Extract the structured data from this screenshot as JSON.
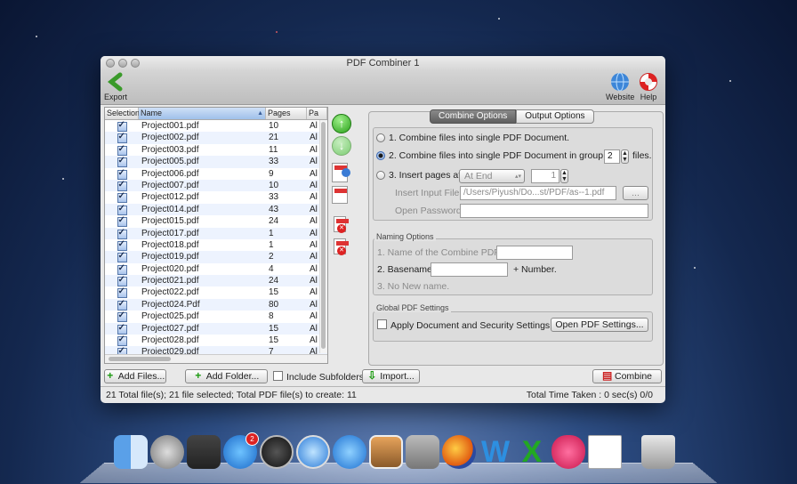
{
  "window": {
    "title": "PDF Combiner 1"
  },
  "toolbar": {
    "export_label": "Export",
    "website_label": "Website",
    "help_label": "Help"
  },
  "table": {
    "columns": [
      "Selection",
      "Name",
      "Pages",
      "Pa"
    ],
    "rows": [
      {
        "name": "Project001.pdf",
        "pages": "10",
        "pa": "Al"
      },
      {
        "name": "Project002.pdf",
        "pages": "21",
        "pa": "Al"
      },
      {
        "name": "Project003.pdf",
        "pages": "11",
        "pa": "Al"
      },
      {
        "name": "Project005.pdf",
        "pages": "33",
        "pa": "Al"
      },
      {
        "name": "Project006.pdf",
        "pages": "9",
        "pa": "Al"
      },
      {
        "name": "Project007.pdf",
        "pages": "10",
        "pa": "Al"
      },
      {
        "name": "Project012.pdf",
        "pages": "33",
        "pa": "Al"
      },
      {
        "name": "Project014.pdf",
        "pages": "43",
        "pa": "Al"
      },
      {
        "name": "Project015.pdf",
        "pages": "24",
        "pa": "Al"
      },
      {
        "name": "Project017.pdf",
        "pages": "1",
        "pa": "Al"
      },
      {
        "name": "Project018.pdf",
        "pages": "1",
        "pa": "Al"
      },
      {
        "name": "Project019.pdf",
        "pages": "2",
        "pa": "Al"
      },
      {
        "name": "Project020.pdf",
        "pages": "4",
        "pa": "Al"
      },
      {
        "name": "Project021.pdf",
        "pages": "24",
        "pa": "Al"
      },
      {
        "name": "Project022.pdf",
        "pages": "15",
        "pa": "Al"
      },
      {
        "name": "Project024.Pdf",
        "pages": "80",
        "pa": "Al"
      },
      {
        "name": "Project025.pdf",
        "pages": "8",
        "pa": "Al"
      },
      {
        "name": "Project027.pdf",
        "pages": "15",
        "pa": "Al"
      },
      {
        "name": "Project028.pdf",
        "pages": "15",
        "pa": "Al"
      },
      {
        "name": "Project029.pdf",
        "pages": "7",
        "pa": "Al"
      }
    ]
  },
  "tabs": {
    "combine": "Combine Options",
    "output": "Output Options"
  },
  "combine_options": {
    "opt1": "1. Combine files into single PDF Document.",
    "opt2_pre": "2. Combine files into single PDF Document in group of",
    "opt2_value": "2",
    "opt2_post": "files.",
    "opt3": "3. Insert pages at",
    "insert_at": "At End",
    "insert_page": "1",
    "insert_input_label": "Insert Input File",
    "insert_input_value": "/Users/Piyush/Do...st/PDF/as--1.pdf",
    "browse": "...",
    "open_password_label": "Open Password"
  },
  "naming": {
    "legend": "Naming Options",
    "opt1": "1. Name of the Combine PDF",
    "opt2": "2. Basename",
    "opt2_post": "+ Number.",
    "opt3": "3. No New name."
  },
  "global": {
    "legend": "Global PDF Settings",
    "apply_label": "Apply Document and Security Settings.",
    "open_settings": "Open PDF Settings..."
  },
  "bottom": {
    "add_files": "Add Files...",
    "add_folder": "Add Folder...",
    "include_subfolders": "Include Subfolders",
    "import": "Import...",
    "combine": "Combine"
  },
  "status": {
    "left": "21 Total file(s); 21 file selected; Total PDF file(s) to create: 11",
    "right": "Total Time Taken : 0 sec(s) 0/0"
  },
  "dock": {
    "appstore_badge": "2"
  }
}
